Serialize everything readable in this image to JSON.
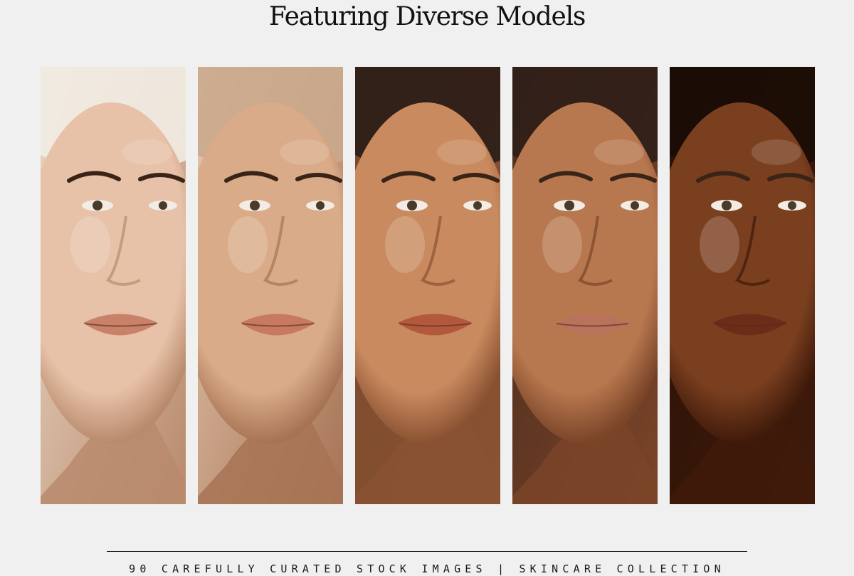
{
  "heading": {
    "title": "Featuring Diverse Models"
  },
  "gallery": {
    "strips": [
      {
        "icon": "portrait-fair-skin-blonde",
        "skin": "#e7c2a8",
        "shade": "#b98a6c",
        "hair": "#f2ece3",
        "lip": "#c9826a",
        "bg": "#ead8c6"
      },
      {
        "icon": "portrait-light-skin-green-eyes",
        "skin": "#d9ab88",
        "shade": "#a77355",
        "hair": "#caa98c",
        "lip": "#c77a5f",
        "bg": "#e6c9b0"
      },
      {
        "icon": "portrait-tan-skin-dark-hair",
        "skin": "#c98a5f",
        "shade": "#8a5232",
        "hair": "#2a1d17",
        "lip": "#b2593d",
        "bg": "#7a4a2e"
      },
      {
        "icon": "portrait-freckled-skin-dark-hair",
        "skin": "#b8784f",
        "shade": "#7a4428",
        "hair": "#2f1f18",
        "lip": "#b9735c",
        "bg": "#4a2c1e"
      },
      {
        "icon": "portrait-deep-skin",
        "skin": "#7a3f1f",
        "shade": "#3f1a0a",
        "hair": "#1a0c06",
        "lip": "#6b2d18",
        "bg": "#2a1208"
      }
    ]
  },
  "footer": {
    "caption": "90 CAREFULLY CURATED STOCK IMAGES | SKINCARE COLLECTION"
  }
}
